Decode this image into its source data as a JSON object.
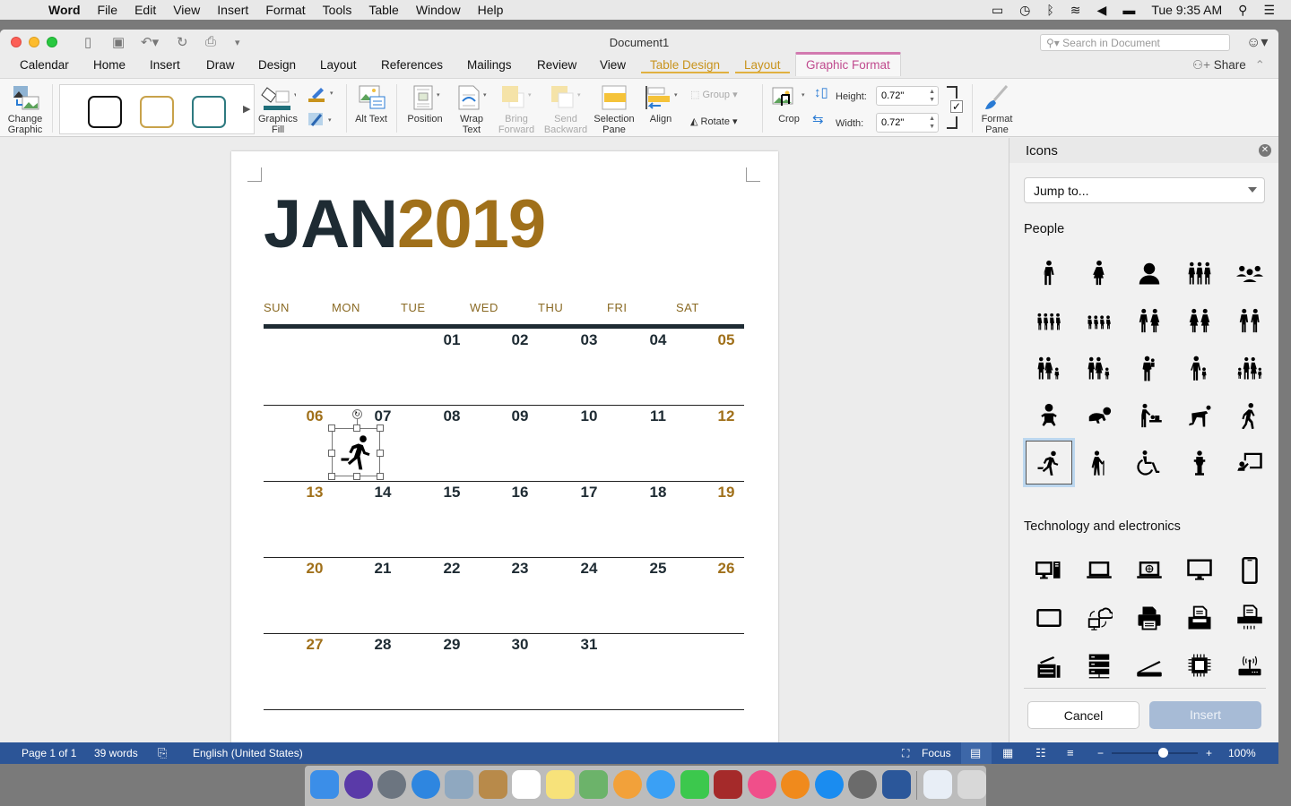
{
  "menubar": {
    "app": "Word",
    "items": [
      "File",
      "Edit",
      "View",
      "Insert",
      "Format",
      "Tools",
      "Table",
      "Window",
      "Help"
    ],
    "clock": "Tue 9:35 AM",
    "status_icons": [
      "airplay-icon",
      "time-machine-icon",
      "bluetooth-icon",
      "wifi-icon",
      "volume-icon",
      "battery-icon",
      "spotlight-icon",
      "notification-center-icon"
    ]
  },
  "window": {
    "title": "Document1",
    "search_placeholder": "Search in Document",
    "share_label": "Share"
  },
  "tabs": [
    {
      "label": "Calendar",
      "type": "normal"
    },
    {
      "label": "Home",
      "type": "normal"
    },
    {
      "label": "Insert",
      "type": "normal"
    },
    {
      "label": "Draw",
      "type": "normal"
    },
    {
      "label": "Design",
      "type": "normal"
    },
    {
      "label": "Layout",
      "type": "normal"
    },
    {
      "label": "References",
      "type": "normal"
    },
    {
      "label": "Mailings",
      "type": "normal"
    },
    {
      "label": "Review",
      "type": "normal"
    },
    {
      "label": "View",
      "type": "normal"
    },
    {
      "label": "Table Design",
      "type": "contextual"
    },
    {
      "label": "Layout",
      "type": "contextual"
    },
    {
      "label": "Graphic Format",
      "type": "active"
    }
  ],
  "ribbon": {
    "change_graphic": "Change Graphic",
    "graphics_fill": "Graphics Fill",
    "alt_text": "Alt Text",
    "position": "Position",
    "wrap_text": "Wrap Text",
    "bring_forward": "Bring Forward",
    "send_backward": "Send Backward",
    "selection_pane": "Selection Pane",
    "align": "Align",
    "group": "Group",
    "rotate": "Rotate",
    "crop": "Crop",
    "height_label": "Height:",
    "height_value": "0.72\"",
    "width_label": "Width:",
    "width_value": "0.72\"",
    "lock_aspect": true,
    "format_pane": "Format Pane",
    "style_swatches": [
      "#111111",
      "#c8a24a",
      "#2e7a80"
    ],
    "fill_color": "#1f6f7a",
    "line_color": "#c8931c"
  },
  "document": {
    "month": "JAN",
    "year": "2019",
    "month_color": "#1e2b33",
    "year_color": "#a0701a",
    "weekdays": [
      "SUN",
      "MON",
      "TUE",
      "WED",
      "THU",
      "FRI",
      "SAT"
    ],
    "weeks": [
      [
        "",
        "",
        "01",
        "02",
        "03",
        "04",
        "05"
      ],
      [
        "06",
        "07",
        "08",
        "09",
        "10",
        "11",
        "12"
      ],
      [
        "13",
        "14",
        "15",
        "16",
        "17",
        "18",
        "19"
      ],
      [
        "20",
        "21",
        "22",
        "23",
        "24",
        "25",
        "26"
      ],
      [
        "27",
        "28",
        "29",
        "30",
        "31",
        "",
        ""
      ]
    ],
    "inserted_icon": "running-person-icon"
  },
  "pane": {
    "title": "Icons",
    "jump_placeholder": "Jump to...",
    "sections": [
      {
        "title": "People",
        "icons": [
          "man",
          "woman",
          "user",
          "group-three",
          "meeting-group",
          "family-four",
          "family-four-children",
          "couple-man-woman",
          "couple-women",
          "couple-men",
          "family-child",
          "family-child-2",
          "father-child",
          "parent-child",
          "family-holding-hands",
          "baby",
          "crawling-baby",
          "changing-table",
          "crawling-adult",
          "walking-person",
          "running-person",
          "elderly-person",
          "wheelchair",
          "podium-speaker",
          "presenter-board"
        ],
        "selected": "running-person"
      },
      {
        "title": "Technology and electronics",
        "icons": [
          "desktop-tower",
          "laptop",
          "laptop-globe",
          "monitor",
          "smartphone",
          "tablet",
          "cloud-sync",
          "printer",
          "printer-document",
          "fax-machine",
          "copier",
          "server",
          "scanner",
          "microchip",
          "wireless-router"
        ]
      }
    ],
    "cancel_label": "Cancel",
    "insert_label": "Insert"
  },
  "statusbar": {
    "page": "Page 1 of 1",
    "words": "39 words",
    "language": "English (United States)",
    "focus": "Focus",
    "zoom": "100%",
    "zoom_percent": 100
  },
  "dock": [
    "Finder",
    "Siri",
    "Launchpad",
    "Safari",
    "Mail",
    "Contacts",
    "Calendar",
    "Notes",
    "Maps",
    "Photos",
    "Messages",
    "FaceTime",
    "Photo Booth",
    "iTunes",
    "iBooks",
    "App Store",
    "System Preferences",
    "Microsoft Word",
    "Downloads",
    "Trash"
  ]
}
